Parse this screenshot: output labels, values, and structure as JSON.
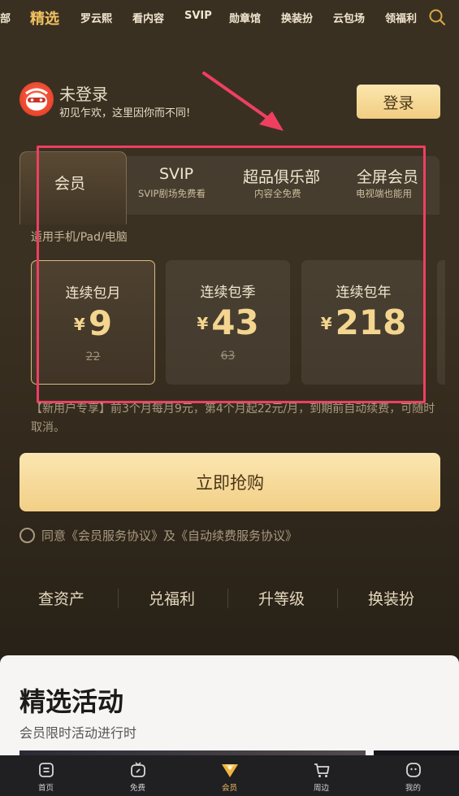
{
  "topnav": {
    "items": [
      "部",
      "精选",
      "罗云熙",
      "看内容",
      "SVIP",
      "勋章馆",
      "换装扮",
      "云包场",
      "领福利"
    ],
    "active_index": 1
  },
  "user": {
    "name": "未登录",
    "subtitle": "初见乍欢，这里因你而不同!",
    "login_label": "登录"
  },
  "tabs": [
    {
      "label": "会员",
      "sub": ""
    },
    {
      "label": "SVIP",
      "sub": "SVIP剧场免费看"
    },
    {
      "label": "超品俱乐部",
      "sub": "内容全免费"
    },
    {
      "label": "全屏会员",
      "sub": "电视端也能用"
    }
  ],
  "device_note": "适用手机/Pad/电脑",
  "plans": [
    {
      "name": "连续包月",
      "currency": "¥",
      "price": "9",
      "original": "22"
    },
    {
      "name": "连续包季",
      "currency": "¥",
      "price": "43",
      "original": "63"
    },
    {
      "name": "连续包年",
      "currency": "¥",
      "price": "218",
      "original": ""
    }
  ],
  "promo": "【新用户专享】前3个月每月9元，第4个月起22元/月，到期前自动续费，可随时取消。",
  "buy_label": "立即抢购",
  "agreement": "同意《会员服务协议》及《自动续费服务协议》",
  "quick_links": [
    "查资产",
    "兑福利",
    "升等级",
    "换装扮"
  ],
  "activities": {
    "title": "精选活动",
    "subtitle": "会员限时活动进行时"
  },
  "bottom_tabs": [
    {
      "label": "首页",
      "icon": "home-icon"
    },
    {
      "label": "免费",
      "icon": "free-tv-icon"
    },
    {
      "label": "会员",
      "icon": "vip-diamond-icon"
    },
    {
      "label": "周边",
      "icon": "cart-icon"
    },
    {
      "label": "我的",
      "icon": "profile-icon"
    }
  ],
  "colors": {
    "accent_gold": "#f0c060",
    "highlight_box": "#ef3f61"
  }
}
